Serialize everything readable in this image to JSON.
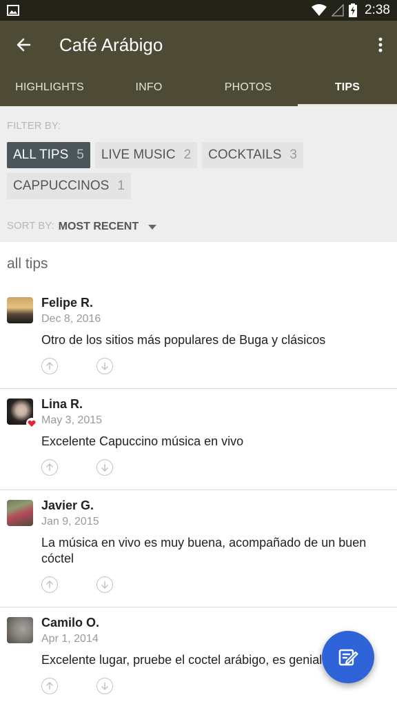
{
  "status_bar": {
    "time": "2:38"
  },
  "app_bar": {
    "title": "Café Arábigo"
  },
  "tabs": [
    {
      "label": "HIGHLIGHTS",
      "active": false
    },
    {
      "label": "INFO",
      "active": false
    },
    {
      "label": "PHOTOS",
      "active": false
    },
    {
      "label": "TIPS",
      "active": true
    }
  ],
  "filter": {
    "label": "FILTER BY:",
    "chips": [
      {
        "label": "ALL TIPS",
        "count": "5",
        "active": true
      },
      {
        "label": "LIVE MUSIC",
        "count": "2",
        "active": false
      },
      {
        "label": "COCKTAILS",
        "count": "3",
        "active": false
      },
      {
        "label": "CAPPUCCINOS",
        "count": "1",
        "active": false
      }
    ]
  },
  "sort": {
    "label": "SORT BY:",
    "value": "MOST RECENT"
  },
  "section_heading": "all tips",
  "tips": [
    {
      "name": "Felipe R.",
      "date": "Dec 8, 2016",
      "text": "Otro de los sitios más populares de Buga y clásicos"
    },
    {
      "name": "Lina R.",
      "date": "May 3, 2015",
      "text": "Excelente Capuccino música en vivo"
    },
    {
      "name": "Javier G.",
      "date": "Jan 9, 2015",
      "text": "La música en vivo es muy buena, acompañado de un buen cóctel"
    },
    {
      "name": "Camilo O.",
      "date": "Apr 1, 2014",
      "text": "Excelente lugar, pruebe el coctel arábigo, es genial"
    }
  ],
  "colors": {
    "app_bar": "#4d4b36",
    "status_bar": "#232319",
    "chip_active": "#4b565a",
    "fab": "#2f63d8",
    "heart": "#e8243c"
  },
  "icons": {
    "back": "arrow-back-icon",
    "more": "more-vert-icon",
    "upvote": "arrow-up-circle-icon",
    "downvote": "arrow-down-circle-icon",
    "fab": "write-tip-icon"
  }
}
